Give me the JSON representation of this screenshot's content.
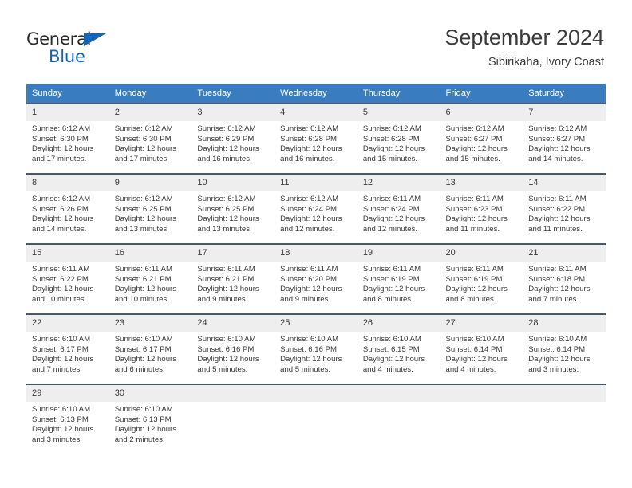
{
  "brand": {
    "name_part1": "General",
    "name_part2": "Blue",
    "triangle_icon": "triangle-icon",
    "accent_color": "#1565b5"
  },
  "header": {
    "title": "September 2024",
    "subtitle": "Sibirikaha, Ivory Coast"
  },
  "theme": {
    "header_row_bg": "#3a7cc0",
    "daynum_bg": "#eeeeee",
    "row_divider": "#4a5a6a",
    "text": "#3b3b3b"
  },
  "weekday_headers": [
    "Sunday",
    "Monday",
    "Tuesday",
    "Wednesday",
    "Thursday",
    "Friday",
    "Saturday"
  ],
  "weeks": [
    [
      {
        "day": "1",
        "sunrise": "Sunrise: 6:12 AM",
        "sunset": "Sunset: 6:30 PM",
        "daylight_line1": "Daylight: 12 hours",
        "daylight_line2": "and 17 minutes."
      },
      {
        "day": "2",
        "sunrise": "Sunrise: 6:12 AM",
        "sunset": "Sunset: 6:30 PM",
        "daylight_line1": "Daylight: 12 hours",
        "daylight_line2": "and 17 minutes."
      },
      {
        "day": "3",
        "sunrise": "Sunrise: 6:12 AM",
        "sunset": "Sunset: 6:29 PM",
        "daylight_line1": "Daylight: 12 hours",
        "daylight_line2": "and 16 minutes."
      },
      {
        "day": "4",
        "sunrise": "Sunrise: 6:12 AM",
        "sunset": "Sunset: 6:28 PM",
        "daylight_line1": "Daylight: 12 hours",
        "daylight_line2": "and 16 minutes."
      },
      {
        "day": "5",
        "sunrise": "Sunrise: 6:12 AM",
        "sunset": "Sunset: 6:28 PM",
        "daylight_line1": "Daylight: 12 hours",
        "daylight_line2": "and 15 minutes."
      },
      {
        "day": "6",
        "sunrise": "Sunrise: 6:12 AM",
        "sunset": "Sunset: 6:27 PM",
        "daylight_line1": "Daylight: 12 hours",
        "daylight_line2": "and 15 minutes."
      },
      {
        "day": "7",
        "sunrise": "Sunrise: 6:12 AM",
        "sunset": "Sunset: 6:27 PM",
        "daylight_line1": "Daylight: 12 hours",
        "daylight_line2": "and 14 minutes."
      }
    ],
    [
      {
        "day": "8",
        "sunrise": "Sunrise: 6:12 AM",
        "sunset": "Sunset: 6:26 PM",
        "daylight_line1": "Daylight: 12 hours",
        "daylight_line2": "and 14 minutes."
      },
      {
        "day": "9",
        "sunrise": "Sunrise: 6:12 AM",
        "sunset": "Sunset: 6:25 PM",
        "daylight_line1": "Daylight: 12 hours",
        "daylight_line2": "and 13 minutes."
      },
      {
        "day": "10",
        "sunrise": "Sunrise: 6:12 AM",
        "sunset": "Sunset: 6:25 PM",
        "daylight_line1": "Daylight: 12 hours",
        "daylight_line2": "and 13 minutes."
      },
      {
        "day": "11",
        "sunrise": "Sunrise: 6:12 AM",
        "sunset": "Sunset: 6:24 PM",
        "daylight_line1": "Daylight: 12 hours",
        "daylight_line2": "and 12 minutes."
      },
      {
        "day": "12",
        "sunrise": "Sunrise: 6:11 AM",
        "sunset": "Sunset: 6:24 PM",
        "daylight_line1": "Daylight: 12 hours",
        "daylight_line2": "and 12 minutes."
      },
      {
        "day": "13",
        "sunrise": "Sunrise: 6:11 AM",
        "sunset": "Sunset: 6:23 PM",
        "daylight_line1": "Daylight: 12 hours",
        "daylight_line2": "and 11 minutes."
      },
      {
        "day": "14",
        "sunrise": "Sunrise: 6:11 AM",
        "sunset": "Sunset: 6:22 PM",
        "daylight_line1": "Daylight: 12 hours",
        "daylight_line2": "and 11 minutes."
      }
    ],
    [
      {
        "day": "15",
        "sunrise": "Sunrise: 6:11 AM",
        "sunset": "Sunset: 6:22 PM",
        "daylight_line1": "Daylight: 12 hours",
        "daylight_line2": "and 10 minutes."
      },
      {
        "day": "16",
        "sunrise": "Sunrise: 6:11 AM",
        "sunset": "Sunset: 6:21 PM",
        "daylight_line1": "Daylight: 12 hours",
        "daylight_line2": "and 10 minutes."
      },
      {
        "day": "17",
        "sunrise": "Sunrise: 6:11 AM",
        "sunset": "Sunset: 6:21 PM",
        "daylight_line1": "Daylight: 12 hours",
        "daylight_line2": "and 9 minutes."
      },
      {
        "day": "18",
        "sunrise": "Sunrise: 6:11 AM",
        "sunset": "Sunset: 6:20 PM",
        "daylight_line1": "Daylight: 12 hours",
        "daylight_line2": "and 9 minutes."
      },
      {
        "day": "19",
        "sunrise": "Sunrise: 6:11 AM",
        "sunset": "Sunset: 6:19 PM",
        "daylight_line1": "Daylight: 12 hours",
        "daylight_line2": "and 8 minutes."
      },
      {
        "day": "20",
        "sunrise": "Sunrise: 6:11 AM",
        "sunset": "Sunset: 6:19 PM",
        "daylight_line1": "Daylight: 12 hours",
        "daylight_line2": "and 8 minutes."
      },
      {
        "day": "21",
        "sunrise": "Sunrise: 6:11 AM",
        "sunset": "Sunset: 6:18 PM",
        "daylight_line1": "Daylight: 12 hours",
        "daylight_line2": "and 7 minutes."
      }
    ],
    [
      {
        "day": "22",
        "sunrise": "Sunrise: 6:10 AM",
        "sunset": "Sunset: 6:17 PM",
        "daylight_line1": "Daylight: 12 hours",
        "daylight_line2": "and 7 minutes."
      },
      {
        "day": "23",
        "sunrise": "Sunrise: 6:10 AM",
        "sunset": "Sunset: 6:17 PM",
        "daylight_line1": "Daylight: 12 hours",
        "daylight_line2": "and 6 minutes."
      },
      {
        "day": "24",
        "sunrise": "Sunrise: 6:10 AM",
        "sunset": "Sunset: 6:16 PM",
        "daylight_line1": "Daylight: 12 hours",
        "daylight_line2": "and 5 minutes."
      },
      {
        "day": "25",
        "sunrise": "Sunrise: 6:10 AM",
        "sunset": "Sunset: 6:16 PM",
        "daylight_line1": "Daylight: 12 hours",
        "daylight_line2": "and 5 minutes."
      },
      {
        "day": "26",
        "sunrise": "Sunrise: 6:10 AM",
        "sunset": "Sunset: 6:15 PM",
        "daylight_line1": "Daylight: 12 hours",
        "daylight_line2": "and 4 minutes."
      },
      {
        "day": "27",
        "sunrise": "Sunrise: 6:10 AM",
        "sunset": "Sunset: 6:14 PM",
        "daylight_line1": "Daylight: 12 hours",
        "daylight_line2": "and 4 minutes."
      },
      {
        "day": "28",
        "sunrise": "Sunrise: 6:10 AM",
        "sunset": "Sunset: 6:14 PM",
        "daylight_line1": "Daylight: 12 hours",
        "daylight_line2": "and 3 minutes."
      }
    ],
    [
      {
        "day": "29",
        "sunrise": "Sunrise: 6:10 AM",
        "sunset": "Sunset: 6:13 PM",
        "daylight_line1": "Daylight: 12 hours",
        "daylight_line2": "and 3 minutes."
      },
      {
        "day": "30",
        "sunrise": "Sunrise: 6:10 AM",
        "sunset": "Sunset: 6:13 PM",
        "daylight_line1": "Daylight: 12 hours",
        "daylight_line2": "and 2 minutes."
      },
      {
        "day": "",
        "sunrise": "",
        "sunset": "",
        "daylight_line1": "",
        "daylight_line2": ""
      },
      {
        "day": "",
        "sunrise": "",
        "sunset": "",
        "daylight_line1": "",
        "daylight_line2": ""
      },
      {
        "day": "",
        "sunrise": "",
        "sunset": "",
        "daylight_line1": "",
        "daylight_line2": ""
      },
      {
        "day": "",
        "sunrise": "",
        "sunset": "",
        "daylight_line1": "",
        "daylight_line2": ""
      },
      {
        "day": "",
        "sunrise": "",
        "sunset": "",
        "daylight_line1": "",
        "daylight_line2": ""
      }
    ]
  ]
}
